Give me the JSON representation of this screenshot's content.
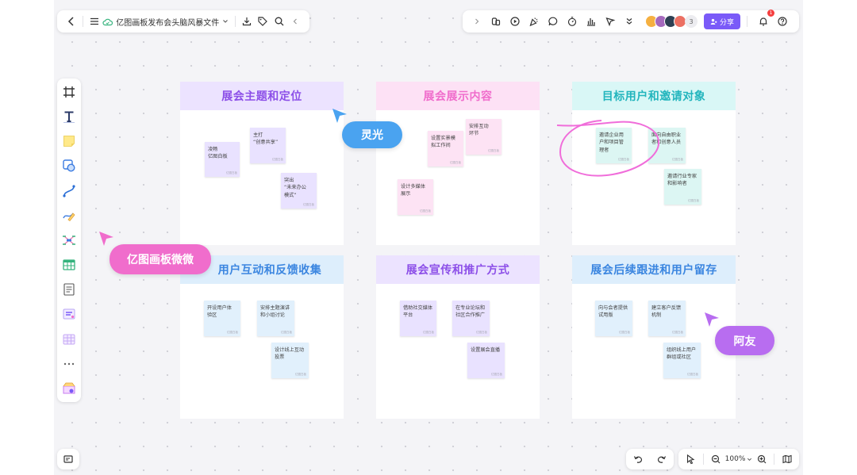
{
  "app": {
    "doc_title": "亿图画板发布会头脑风暴文件",
    "share_label": "分享",
    "collaborator_count": "3",
    "notification_count": "1",
    "zoom": "100%"
  },
  "colors": {
    "accent": "#7a5af8",
    "purple_head": "#ece3ff",
    "purple_text": "#8c4fe8",
    "pink_head": "#fde1f5",
    "pink_text": "#f06dcc",
    "cyan_head": "#d9f7f6",
    "cyan_text": "#22b5bd",
    "blue_head": "#ddeefc",
    "blue_text": "#3b86e0"
  },
  "frames": [
    {
      "title": "展会主题和定位",
      "notes": [
        {
          "text": "凌畅\n亿图白板",
          "tag": "亿图白板"
        },
        {
          "text": "主打\n“创意共享”",
          "tag": "亿图白板"
        },
        {
          "text": "突出\n“未来办公\n模式”",
          "tag": "亿图白板"
        }
      ]
    },
    {
      "title": "展会展示内容",
      "notes": [
        {
          "text": "设置实景模\n拟工作间",
          "tag": "亿图白板"
        },
        {
          "text": "安排互动\n环节",
          "tag": "亿图白板"
        },
        {
          "text": "设计多媒体\n展示",
          "tag": "亿图白板"
        }
      ]
    },
    {
      "title": "目标用户和邀请对象",
      "notes": [
        {
          "text": "邀请企业用\n户和项目管\n理者",
          "tag": "亿图白板"
        },
        {
          "text": "面向自由职业\n者和创意人员",
          "tag": "亿图白板"
        },
        {
          "text": "邀请行业专家\n和影响者",
          "tag": "亿图白板"
        }
      ]
    },
    {
      "title": "用户互动和反馈收集",
      "notes": [
        {
          "text": "开设用户体\n验区",
          "tag": "亿图白板"
        },
        {
          "text": "安排主题演讲\n和小组讨论",
          "tag": "亿图白板"
        },
        {
          "text": "设计线上互动\n投票",
          "tag": "亿图白板"
        }
      ]
    },
    {
      "title": "展会宣传和推广方式",
      "notes": [
        {
          "text": "借助社交媒体\n平台",
          "tag": "亿图白板"
        },
        {
          "text": "在专业论坛和\n社区合作推广",
          "tag": "亿图白板"
        },
        {
          "text": "设置展会直播",
          "tag": "亿图白板"
        }
      ]
    },
    {
      "title": "展会后续跟进和用户留存",
      "notes": [
        {
          "text": "向与会者提供\n试用版",
          "tag": "亿图白板"
        },
        {
          "text": "建立客户反馈\n机制",
          "tag": "亿图白板"
        },
        {
          "text": "组织线上用户\n群组或社区",
          "tag": "亿图白板"
        }
      ]
    }
  ],
  "cursors": [
    {
      "name": "灵光",
      "color": "#4aa3f0"
    },
    {
      "name": "亿图画板微微",
      "color": "#f06dcc"
    },
    {
      "name": "阿友",
      "color": "#b86df0"
    }
  ]
}
